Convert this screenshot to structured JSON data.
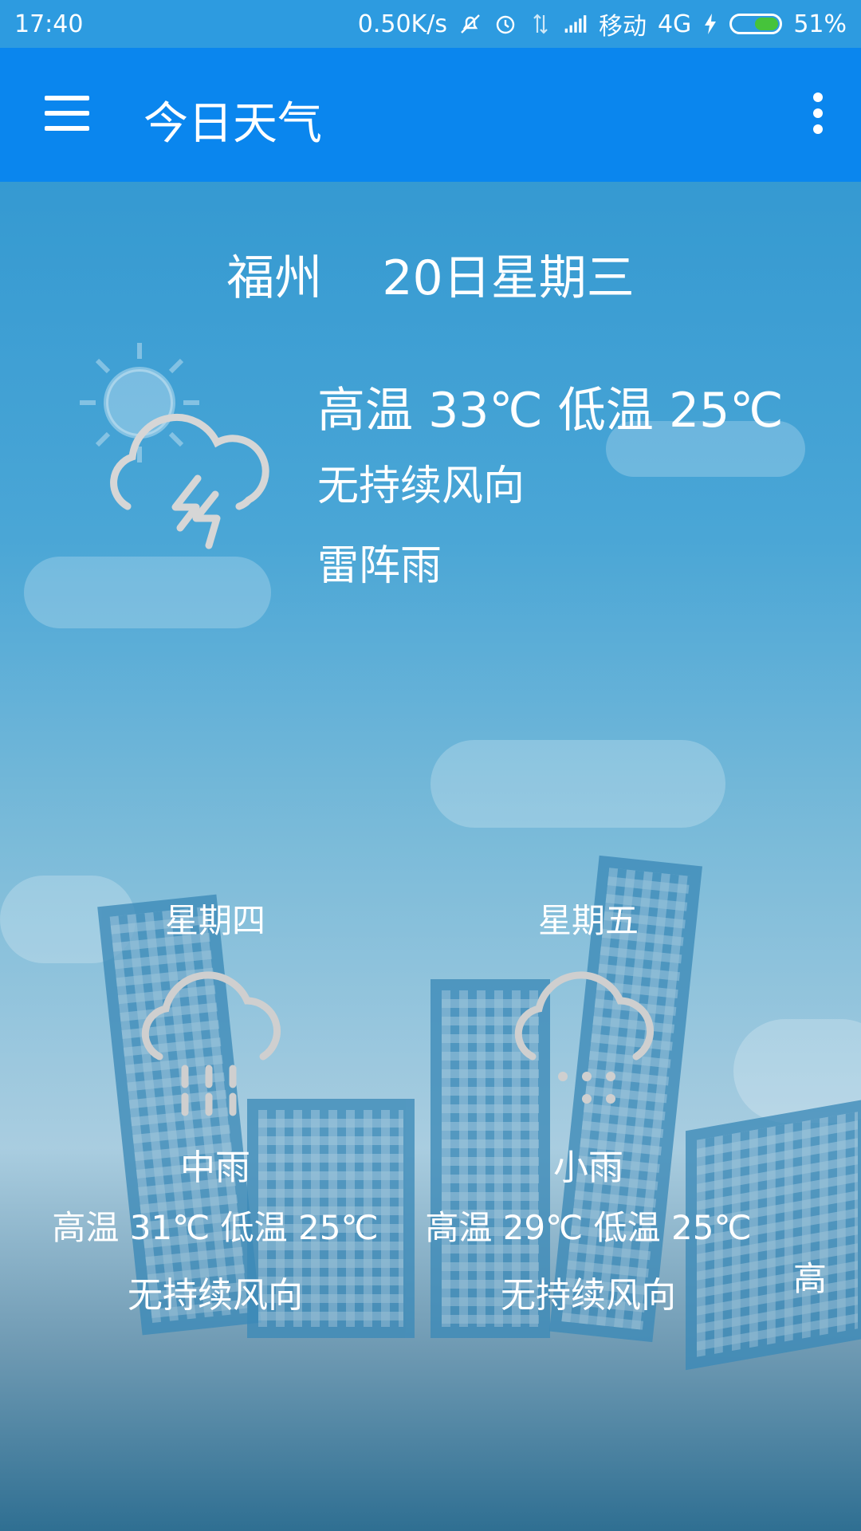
{
  "status_bar": {
    "time": "17:40",
    "network_speed": "0.50K/s",
    "carrier": "移动",
    "network_type": "4G",
    "battery": "51%",
    "battery_level": 0.51,
    "icons": [
      "mute-icon",
      "alarm-icon",
      "data-arrows-icon",
      "signal-icon",
      "charging-icon",
      "battery-icon"
    ]
  },
  "app_bar": {
    "title": "今日天气",
    "menu_icon": "hamburger-menu-icon",
    "more_icon": "more-vertical-icon",
    "color": "#0a86ee"
  },
  "today": {
    "city": "福州",
    "date": "20日星期三",
    "temperature": "高温 33℃ 低温 25℃",
    "wind": "无持续风向",
    "condition": "雷阵雨",
    "icon": "thunderstorm-icon"
  },
  "forecast": [
    {
      "day": "星期四",
      "icon": "rain-icon",
      "condition": "中雨",
      "temperature": "高温 31℃ 低温 25℃",
      "wind": "无持续风向"
    },
    {
      "day": "星期五",
      "icon": "light-rain-icon",
      "condition": "小雨",
      "temperature": "高温 29℃ 低温 25℃",
      "wind": "无持续风向"
    }
  ],
  "forecast_clipped_text": "高"
}
